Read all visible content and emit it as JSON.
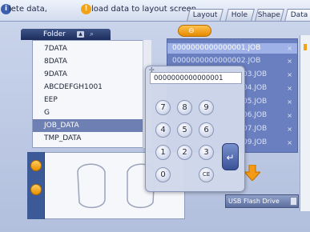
{
  "instructions": {
    "select_text": "lete data,",
    "load_text": "load data to layout screen"
  },
  "tabs": [
    {
      "label": "Layout"
    },
    {
      "label": "Hole"
    },
    {
      "label": "Shape"
    },
    {
      "label": "Data"
    }
  ],
  "folder_panel": {
    "title": "Folder",
    "up_icon": "up-triangle-icon",
    "search_icon": "magnifier-icon",
    "items": [
      {
        "label": "7DATA"
      },
      {
        "label": "8DATA"
      },
      {
        "label": "9DATA"
      },
      {
        "label": "ABCDEFGH1001"
      },
      {
        "label": "EEP"
      },
      {
        "label": "G"
      },
      {
        "label": "JOB_DATA"
      },
      {
        "label": "TMP_DATA"
      }
    ],
    "selected_index": 6
  },
  "job_list": {
    "items": [
      {
        "label": "0000000000000001.JOB"
      },
      {
        "label": "0000000000000002.JOB"
      },
      {
        "label": "03.JOB"
      },
      {
        "label": "04.JOB"
      },
      {
        "label": "05.JOB"
      },
      {
        "label": "06.JOB"
      },
      {
        "label": "07.JOB"
      },
      {
        "label": "09.JOB"
      }
    ],
    "selected_index": 0
  },
  "keypad": {
    "display_value": "0000000000000001",
    "keys": [
      "7",
      "8",
      "9",
      "4",
      "5",
      "6",
      "1",
      "2",
      "3",
      "0"
    ],
    "clear_label": "CE",
    "enter_icon": "enter-arrow-icon"
  },
  "usb": {
    "label": "USB Flash Drive"
  },
  "colors": {
    "accent": "#f2a316",
    "panel_dark": "#1c2d5c",
    "list_bg": "#6a7fbf"
  }
}
